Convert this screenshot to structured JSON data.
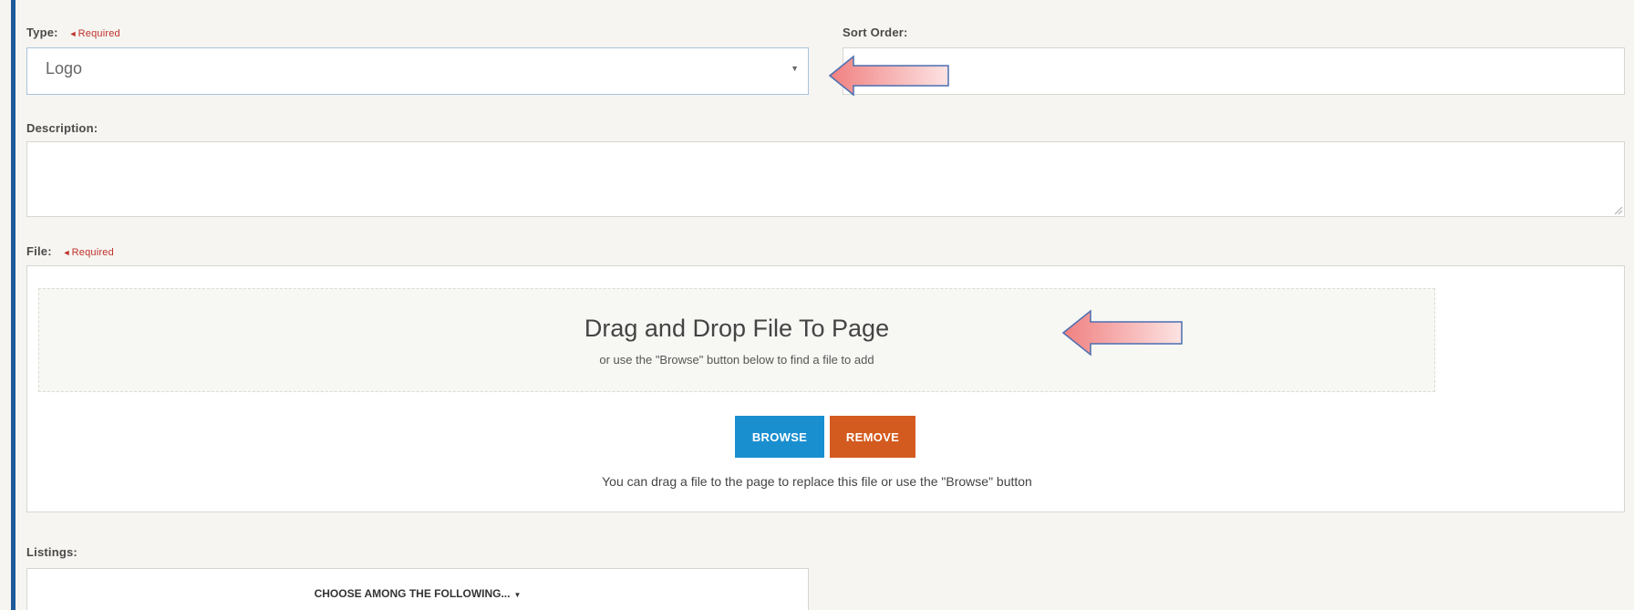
{
  "type_field": {
    "label": "Type:",
    "required": "Required",
    "value": "Logo"
  },
  "sort_order": {
    "label": "Sort Order:",
    "value": ""
  },
  "description": {
    "label": "Description:",
    "value": ""
  },
  "file": {
    "label": "File:",
    "required": "Required",
    "drop_title": "Drag and Drop File To Page",
    "drop_subtitle": "or use the \"Browse\" button below to find a file to add",
    "browse_label": "BROWSE",
    "remove_label": "REMOVE",
    "help_text": "You can drag a file to the page to replace this file or use the \"Browse\" button"
  },
  "listings": {
    "label": "Listings:",
    "select_label": "CHOOSE AMONG THE FOLLOWING..."
  },
  "icons": {
    "required_marker": "◄",
    "caret": "▼",
    "annotation_arrow": "left-arrow-icon"
  },
  "colors": {
    "accent_bar": "#1f5a9a",
    "required": "#c0302a",
    "browse": "#1a8fd0",
    "remove": "#d35b1f"
  }
}
